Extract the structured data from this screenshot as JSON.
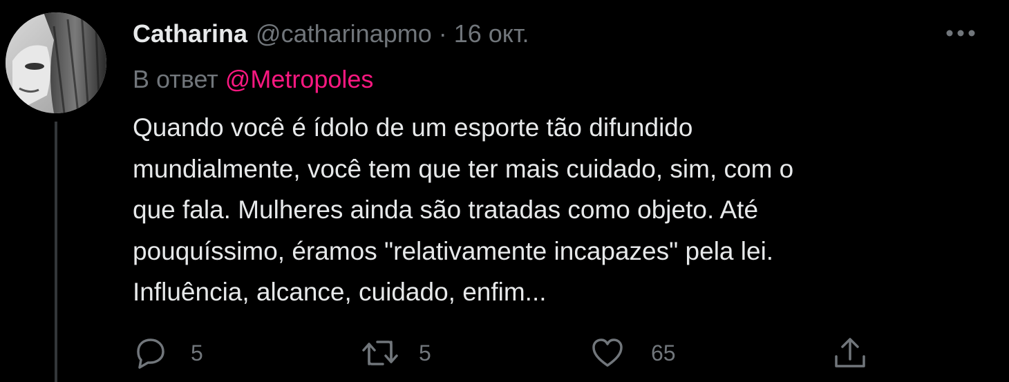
{
  "tweet": {
    "author_name": "Catharina",
    "author_handle": "@catharinapmo",
    "separator": "·",
    "date": "16 окт.",
    "reply_prefix": "В ответ",
    "reply_mention": "@Metropoles",
    "text_lines": [
      "Quando você é ídolo de um esporte tão difundido",
      "mundialmente, você tem que ter mais cuidado, sim, com o",
      "que fala. Mulheres ainda são tratadas como objeto. Até",
      "pouquíssimo, éramos \"relativamente incapazes\" pela lei.",
      "Influência, alcance, cuidado, enfim..."
    ],
    "counts": {
      "replies": "5",
      "retweets": "5",
      "likes": "65"
    }
  },
  "icons": {
    "more": "more-horizontal-icon",
    "reply": "reply-bubble-icon",
    "retweet": "retweet-icon",
    "like": "heart-icon",
    "share": "share-upload-icon"
  },
  "colors": {
    "background": "#000000",
    "primary_text": "#e7e9ea",
    "secondary_text": "#71767b",
    "mention": "#f91880",
    "thread_line": "#333639"
  }
}
